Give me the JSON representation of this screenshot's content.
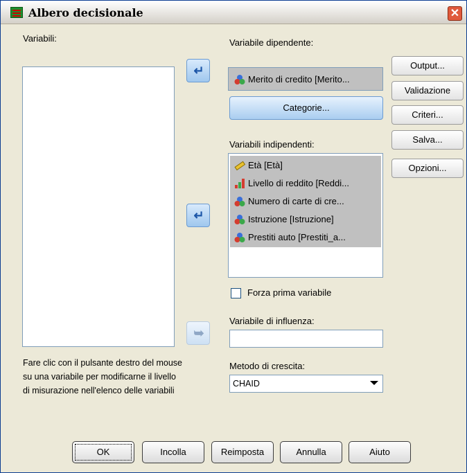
{
  "window": {
    "title": "Albero decisionale"
  },
  "variables_label": "Variabili:",
  "dependent": {
    "label": "Variabile dipendente:",
    "value": "Merito di credito [Merito...",
    "icon": "nominal-variable-icon",
    "categories_button": "Categorie..."
  },
  "independent": {
    "label": "Variabili indipendenti:",
    "items": [
      {
        "label": "Età [Età]",
        "icon": "scale-variable-icon"
      },
      {
        "label": "Livello di reddito [Reddi...",
        "icon": "ordinal-variable-icon"
      },
      {
        "label": "Numero di carte di cre...",
        "icon": "nominal-variable-icon"
      },
      {
        "label": "Istruzione [Istruzione]",
        "icon": "nominal-variable-icon"
      },
      {
        "label": "Prestiti auto [Prestiti_a...",
        "icon": "nominal-variable-icon"
      }
    ]
  },
  "force_first": {
    "label": "Forza prima variabile",
    "checked": false
  },
  "influence": {
    "label": "Variabile di influenza:",
    "value": ""
  },
  "growth": {
    "label": "Metodo di crescita:",
    "selected": "CHAID"
  },
  "note": "Fare clic con il pulsante destro del mouse su una variabile per modificarne il livello di misurazione nell'elenco delle variabili",
  "side_buttons": [
    "Output...",
    "Validazione",
    "Criteri...",
    "Salva...",
    "Opzioni..."
  ],
  "bottom_buttons": [
    "OK",
    "Incolla",
    "Reimposta",
    "Annulla",
    "Aiuto"
  ],
  "colors": {
    "dialog_bg": "#ece9d8",
    "accent_blue": "#a9cdf0",
    "selected_list_bg": "#c0c0c0",
    "close_red": "#e05a3c"
  }
}
